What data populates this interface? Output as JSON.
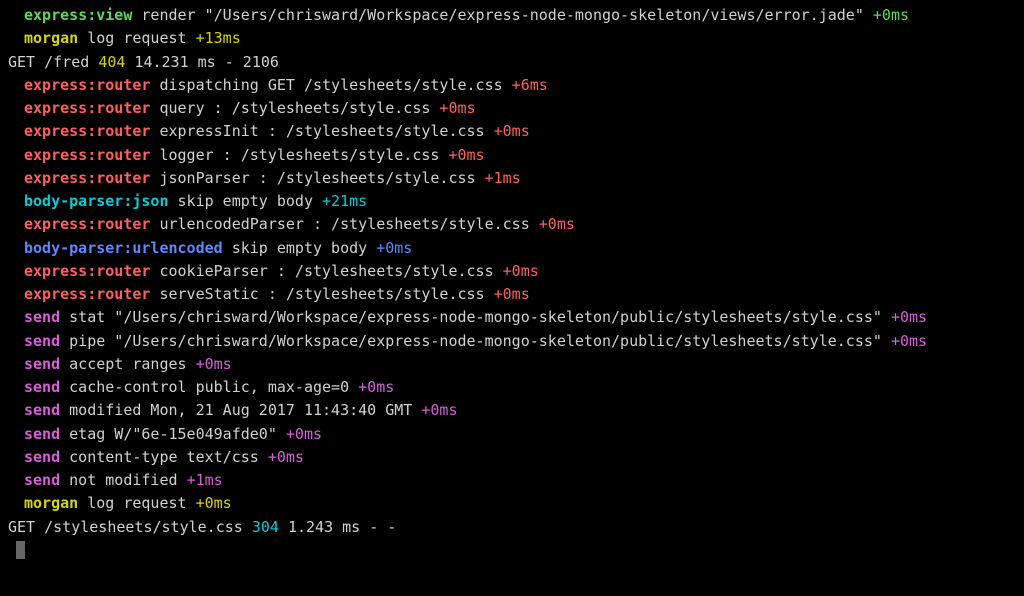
{
  "lines": [
    {
      "indent": true,
      "parts": [
        {
          "text": "express:view",
          "cls": "green bold"
        },
        {
          "text": " render \"/Users/chrisward/Workspace/express-node-mongo-skeleton/views/error.jade\" ",
          "cls": "white"
        },
        {
          "text": "+0ms",
          "cls": "green"
        }
      ]
    },
    {
      "indent": true,
      "parts": [
        {
          "text": "morgan",
          "cls": "yellow bold"
        },
        {
          "text": " log request ",
          "cls": "white"
        },
        {
          "text": "+13ms",
          "cls": "yellow"
        }
      ]
    },
    {
      "indent": false,
      "parts": [
        {
          "text": "GET /fred ",
          "cls": "white"
        },
        {
          "text": "404",
          "cls": "yellow"
        },
        {
          "text": " 14.231 ms - 2106",
          "cls": "white"
        }
      ]
    },
    {
      "indent": true,
      "parts": [
        {
          "text": "express:router",
          "cls": "red bold"
        },
        {
          "text": " dispatching GET /stylesheets/style.css ",
          "cls": "white"
        },
        {
          "text": "+6ms",
          "cls": "red"
        }
      ]
    },
    {
      "indent": true,
      "parts": [
        {
          "text": "express:router",
          "cls": "red bold"
        },
        {
          "text": " query  : /stylesheets/style.css ",
          "cls": "white"
        },
        {
          "text": "+0ms",
          "cls": "red"
        }
      ]
    },
    {
      "indent": true,
      "parts": [
        {
          "text": "express:router",
          "cls": "red bold"
        },
        {
          "text": " expressInit  : /stylesheets/style.css ",
          "cls": "white"
        },
        {
          "text": "+0ms",
          "cls": "red"
        }
      ]
    },
    {
      "indent": true,
      "parts": [
        {
          "text": "express:router",
          "cls": "red bold"
        },
        {
          "text": " logger  : /stylesheets/style.css ",
          "cls": "white"
        },
        {
          "text": "+0ms",
          "cls": "red"
        }
      ]
    },
    {
      "indent": true,
      "parts": [
        {
          "text": "express:router",
          "cls": "red bold"
        },
        {
          "text": " jsonParser  : /stylesheets/style.css ",
          "cls": "white"
        },
        {
          "text": "+1ms",
          "cls": "red"
        }
      ]
    },
    {
      "indent": true,
      "parts": [
        {
          "text": "body-parser:json",
          "cls": "cyan bold"
        },
        {
          "text": " skip empty body ",
          "cls": "white"
        },
        {
          "text": "+21ms",
          "cls": "cyan"
        }
      ]
    },
    {
      "indent": true,
      "parts": [
        {
          "text": "express:router",
          "cls": "red bold"
        },
        {
          "text": " urlencodedParser  : /stylesheets/style.css ",
          "cls": "white"
        },
        {
          "text": "+0ms",
          "cls": "red"
        }
      ]
    },
    {
      "indent": true,
      "parts": [
        {
          "text": "body-parser:urlencoded",
          "cls": "blue bold"
        },
        {
          "text": " skip empty body ",
          "cls": "white"
        },
        {
          "text": "+0ms",
          "cls": "blue"
        }
      ]
    },
    {
      "indent": true,
      "parts": [
        {
          "text": "express:router",
          "cls": "red bold"
        },
        {
          "text": " cookieParser  : /stylesheets/style.css ",
          "cls": "white"
        },
        {
          "text": "+0ms",
          "cls": "red"
        }
      ]
    },
    {
      "indent": true,
      "parts": [
        {
          "text": "express:router",
          "cls": "red bold"
        },
        {
          "text": " serveStatic  : /stylesheets/style.css ",
          "cls": "white"
        },
        {
          "text": "+0ms",
          "cls": "red"
        }
      ]
    },
    {
      "indent": true,
      "parts": [
        {
          "text": "send",
          "cls": "magenta bold"
        },
        {
          "text": " stat \"/Users/chrisward/Workspace/express-node-mongo-skeleton/public/stylesheets/style.css\" ",
          "cls": "white"
        },
        {
          "text": "+0ms",
          "cls": "magenta"
        }
      ]
    },
    {
      "indent": true,
      "parts": [
        {
          "text": "send",
          "cls": "magenta bold"
        },
        {
          "text": " pipe \"/Users/chrisward/Workspace/express-node-mongo-skeleton/public/stylesheets/style.css\" ",
          "cls": "white"
        },
        {
          "text": "+0ms",
          "cls": "magenta"
        }
      ]
    },
    {
      "indent": true,
      "parts": [
        {
          "text": "send",
          "cls": "magenta bold"
        },
        {
          "text": " accept ranges ",
          "cls": "white"
        },
        {
          "text": "+0ms",
          "cls": "magenta"
        }
      ]
    },
    {
      "indent": true,
      "parts": [
        {
          "text": "send",
          "cls": "magenta bold"
        },
        {
          "text": " cache-control public, max-age=0 ",
          "cls": "white"
        },
        {
          "text": "+0ms",
          "cls": "magenta"
        }
      ]
    },
    {
      "indent": true,
      "parts": [
        {
          "text": "send",
          "cls": "magenta bold"
        },
        {
          "text": " modified Mon, 21 Aug 2017 11:43:40 GMT ",
          "cls": "white"
        },
        {
          "text": "+0ms",
          "cls": "magenta"
        }
      ]
    },
    {
      "indent": true,
      "parts": [
        {
          "text": "send",
          "cls": "magenta bold"
        },
        {
          "text": " etag W/\"6e-15e049afde0\" ",
          "cls": "white"
        },
        {
          "text": "+0ms",
          "cls": "magenta"
        }
      ]
    },
    {
      "indent": true,
      "parts": [
        {
          "text": "send",
          "cls": "magenta bold"
        },
        {
          "text": " content-type text/css ",
          "cls": "white"
        },
        {
          "text": "+0ms",
          "cls": "magenta"
        }
      ]
    },
    {
      "indent": true,
      "parts": [
        {
          "text": "send",
          "cls": "magenta bold"
        },
        {
          "text": " not modified ",
          "cls": "white"
        },
        {
          "text": "+1ms",
          "cls": "magenta"
        }
      ]
    },
    {
      "indent": true,
      "parts": [
        {
          "text": "morgan",
          "cls": "yellow bold"
        },
        {
          "text": " log request ",
          "cls": "white"
        },
        {
          "text": "+0ms",
          "cls": "yellow"
        }
      ]
    },
    {
      "indent": false,
      "parts": [
        {
          "text": "GET /stylesheets/style.css ",
          "cls": "white"
        },
        {
          "text": "304",
          "cls": "cyan"
        },
        {
          "text": " 1.243 ms - -",
          "cls": "white"
        }
      ]
    }
  ]
}
